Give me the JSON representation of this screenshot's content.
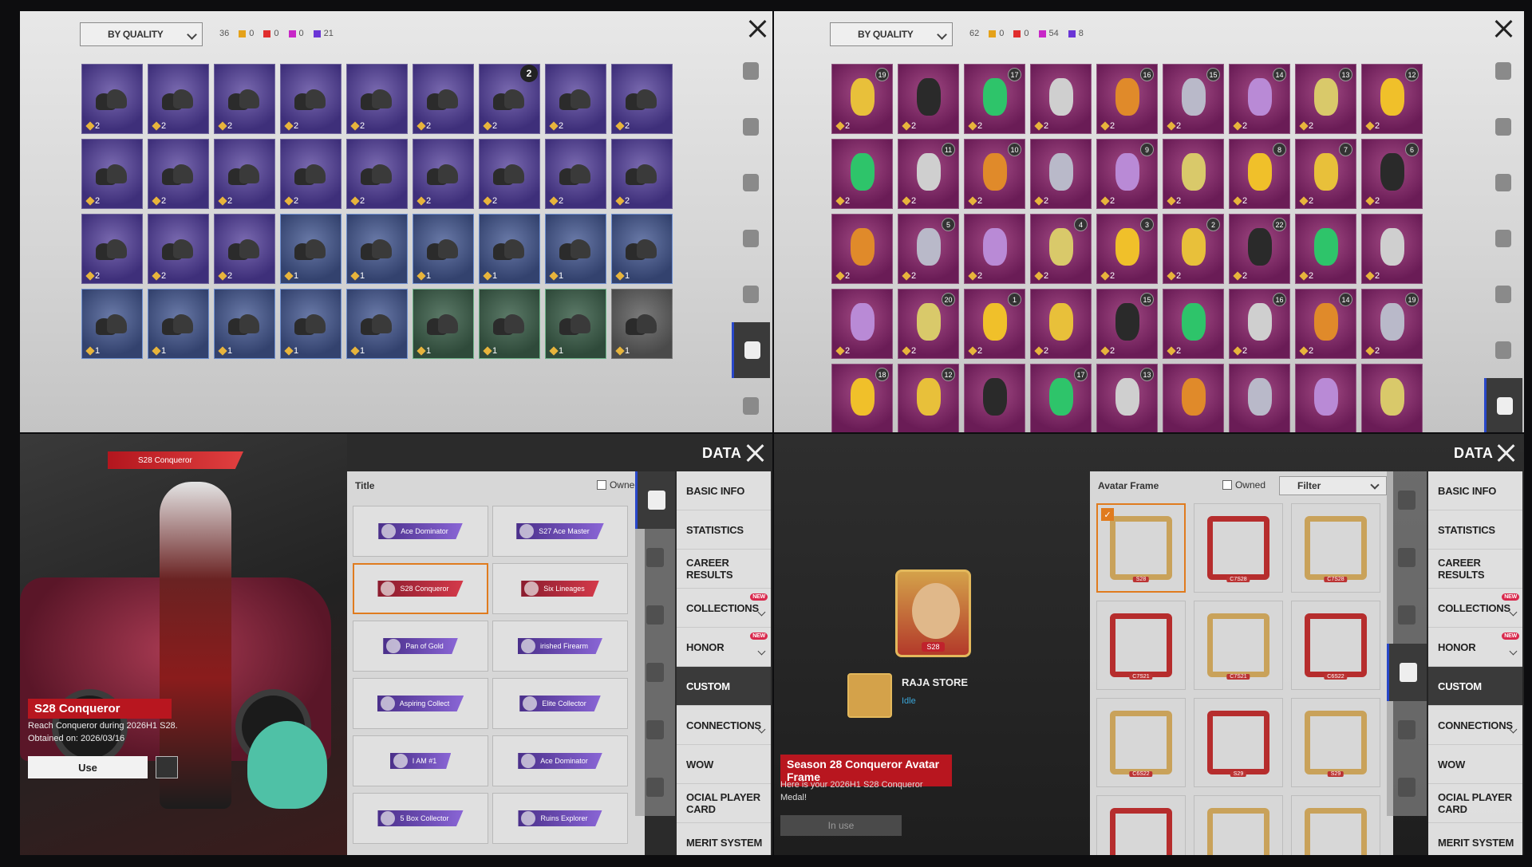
{
  "shoes_panel": {
    "sort_label": "BY QUALITY",
    "total": "36",
    "counts": [
      {
        "color": "#e5a21a",
        "value": "0"
      },
      {
        "color": "#e02d2d",
        "value": "0"
      },
      {
        "color": "#c727c7",
        "value": "0"
      },
      {
        "color": "#6a35d6",
        "value": "21"
      }
    ],
    "rows": [
      {
        "quality": "purple",
        "counts": [
          "2",
          "2",
          "2",
          "2",
          "2",
          "2",
          "2",
          "2",
          "2"
        ]
      },
      {
        "quality": "purple",
        "counts": [
          "2",
          "2",
          "2",
          "2",
          "2",
          "2",
          "2",
          "2",
          "2"
        ]
      },
      {
        "quality": "blue",
        "counts": [
          "2",
          "2",
          "2",
          "1",
          "1",
          "1",
          "1",
          "1",
          "1"
        ]
      },
      {
        "quality": "mixed",
        "counts": [
          "1",
          "1",
          "1",
          "1",
          "1",
          "1",
          "1",
          "1",
          "1"
        ]
      }
    ],
    "badge": "2",
    "sidebar_icons": [
      "glasses-icon",
      "mask-icon",
      "jacket-icon",
      "backpack-icon",
      "pants-icon",
      "shoes-icon",
      "bottle-icon"
    ]
  },
  "pendant_panel": {
    "sort_label": "BY QUALITY",
    "total": "62",
    "counts": [
      {
        "color": "#e5a21a",
        "value": "0"
      },
      {
        "color": "#e02d2d",
        "value": "0"
      },
      {
        "color": "#c727c7",
        "value": "54"
      },
      {
        "color": "#6a35d6",
        "value": "8"
      }
    ],
    "rows": [
      {
        "levels": [
          "19",
          "",
          "17",
          "",
          "16",
          "15",
          "14",
          "13",
          "12"
        ],
        "counts": [
          "2",
          "2",
          "2",
          "2",
          "2",
          "2",
          "2",
          "2",
          "2"
        ]
      },
      {
        "levels": [
          "",
          "11",
          "10",
          "",
          "9",
          "",
          "8",
          "7",
          "6"
        ],
        "counts": [
          "2",
          "2",
          "2",
          "2",
          "2",
          "2",
          "2",
          "2",
          "2"
        ]
      },
      {
        "levels": [
          "",
          "5",
          "",
          "4",
          "3",
          "2",
          "22",
          "",
          ""
        ],
        "counts": [
          "2",
          "2",
          "2",
          "2",
          "2",
          "2",
          "2",
          "2",
          "2"
        ]
      },
      {
        "levels": [
          "",
          "20",
          "1",
          "",
          "15",
          "",
          "16",
          "14",
          "19"
        ],
        "counts": [
          "2",
          "2",
          "2",
          "2",
          "2",
          "2",
          "2",
          "2",
          "2"
        ]
      },
      {
        "levels": [
          "18",
          "12",
          "",
          "17",
          "13",
          "",
          "",
          "",
          ""
        ],
        "counts": [
          "",
          "",
          "",
          "",
          "",
          "",
          "",
          "",
          ""
        ]
      }
    ]
  },
  "title_panel": {
    "data_label": "DATA",
    "banner_title": "S28 Conqueror",
    "list_header": "Title",
    "owned_label": "Owned",
    "titles": [
      {
        "name": "Ace Dominator",
        "style": "purple"
      },
      {
        "name": "S27 Ace Master",
        "style": "purple"
      },
      {
        "name": "S28 Conqueror",
        "style": "red",
        "selected": true
      },
      {
        "name": "Six Lineages",
        "style": "red"
      },
      {
        "name": "Pan of Gold",
        "style": "purple"
      },
      {
        "name": "irished Firearm",
        "style": "purple"
      },
      {
        "name": "Aspiring Collect",
        "style": "purple"
      },
      {
        "name": "Elite Collector",
        "style": "purple"
      },
      {
        "name": "I AM #1",
        "style": "purple"
      },
      {
        "name": "Ace Dominator",
        "style": "purple"
      },
      {
        "name": "5 Box Collector",
        "style": "purple"
      },
      {
        "name": "Ruins Explorer",
        "style": "purple"
      }
    ],
    "detail_title": "S28 Conqueror",
    "detail_desc1": "Reach Conqueror during 2026H1 S28.",
    "detail_desc2": "Obtained on: 2026/03/16",
    "use_label": "Use"
  },
  "nav": [
    {
      "label": "BASIC INFO",
      "new": false,
      "expand": false
    },
    {
      "label": "STATISTICS",
      "new": false,
      "expand": false
    },
    {
      "label": "CAREER RESULTS",
      "new": false,
      "expand": false
    },
    {
      "label": "COLLECTIONS",
      "new": true,
      "expand": true
    },
    {
      "label": "HONOR",
      "new": true,
      "expand": true
    },
    {
      "label": "CUSTOM",
      "new": false,
      "expand": false,
      "active": true
    },
    {
      "label": "CONNECTIONS",
      "new": false,
      "expand": true
    },
    {
      "label": "WOW",
      "new": false,
      "expand": false
    },
    {
      "label": "OCIAL PLAYER CARD",
      "new": false,
      "expand": false
    },
    {
      "label": "MERIT SYSTEM",
      "new": false,
      "expand": false
    }
  ],
  "nav_new_badge": "NEW",
  "frame_panel": {
    "data_label": "DATA",
    "list_header": "Avatar Frame",
    "owned_label": "Owned",
    "filter_label": "Filter",
    "avatar_label": "S28",
    "player_name": "RAJA STORE",
    "player_status": "Idle",
    "detail_title": "Season 28 Conqueror Avatar Frame",
    "detail_desc1": "Here is your 2026H1 S28 Conqueror",
    "detail_desc2": "Medal!",
    "inuse_label": "In use",
    "frames": [
      {
        "label": "S28",
        "style": "gold",
        "selected": true
      },
      {
        "label": "C7S28",
        "style": "red"
      },
      {
        "label": "C7S28",
        "style": "gold"
      },
      {
        "label": "C7S21",
        "style": "red"
      },
      {
        "label": "C7S21",
        "style": "gold"
      },
      {
        "label": "C6S22",
        "style": "red"
      },
      {
        "label": "C6S22",
        "style": "gold"
      },
      {
        "label": "S29",
        "style": "red"
      },
      {
        "label": "S29",
        "style": "gold"
      },
      {
        "label": "",
        "style": "red"
      },
      {
        "label": "",
        "style": "gold"
      },
      {
        "label": "",
        "style": "gold"
      }
    ]
  }
}
